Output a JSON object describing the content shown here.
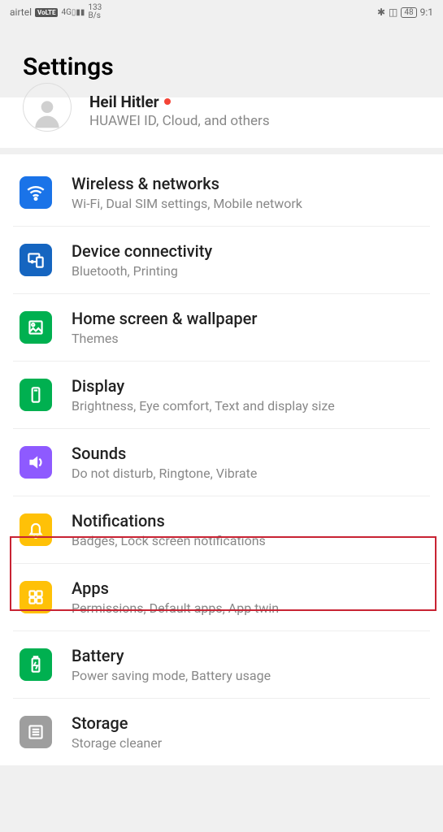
{
  "statusbar": {
    "carrier": "airtel",
    "volte": "VoLTE",
    "signal": "4G",
    "speed_top": "133",
    "speed_bottom": "B/s",
    "battery": "48",
    "time": "9:1"
  },
  "header": {
    "title": "Settings"
  },
  "account": {
    "name": "Heil Hitler",
    "desc": "HUAWEI ID, Cloud, and others"
  },
  "items": [
    {
      "title": "Wireless & networks",
      "desc": "Wi-Fi, Dual SIM settings, Mobile network"
    },
    {
      "title": "Device connectivity",
      "desc": "Bluetooth, Printing"
    },
    {
      "title": "Home screen & wallpaper",
      "desc": "Themes"
    },
    {
      "title": "Display",
      "desc": "Brightness, Eye comfort, Text and display size"
    },
    {
      "title": "Sounds",
      "desc": "Do not disturb, Ringtone, Vibrate"
    },
    {
      "title": "Notifications",
      "desc": "Badges, Lock screen notifications"
    },
    {
      "title": "Apps",
      "desc": "Permissions, Default apps, App twin"
    },
    {
      "title": "Battery",
      "desc": "Power saving mode, Battery usage"
    },
    {
      "title": "Storage",
      "desc": "Storage cleaner"
    }
  ]
}
